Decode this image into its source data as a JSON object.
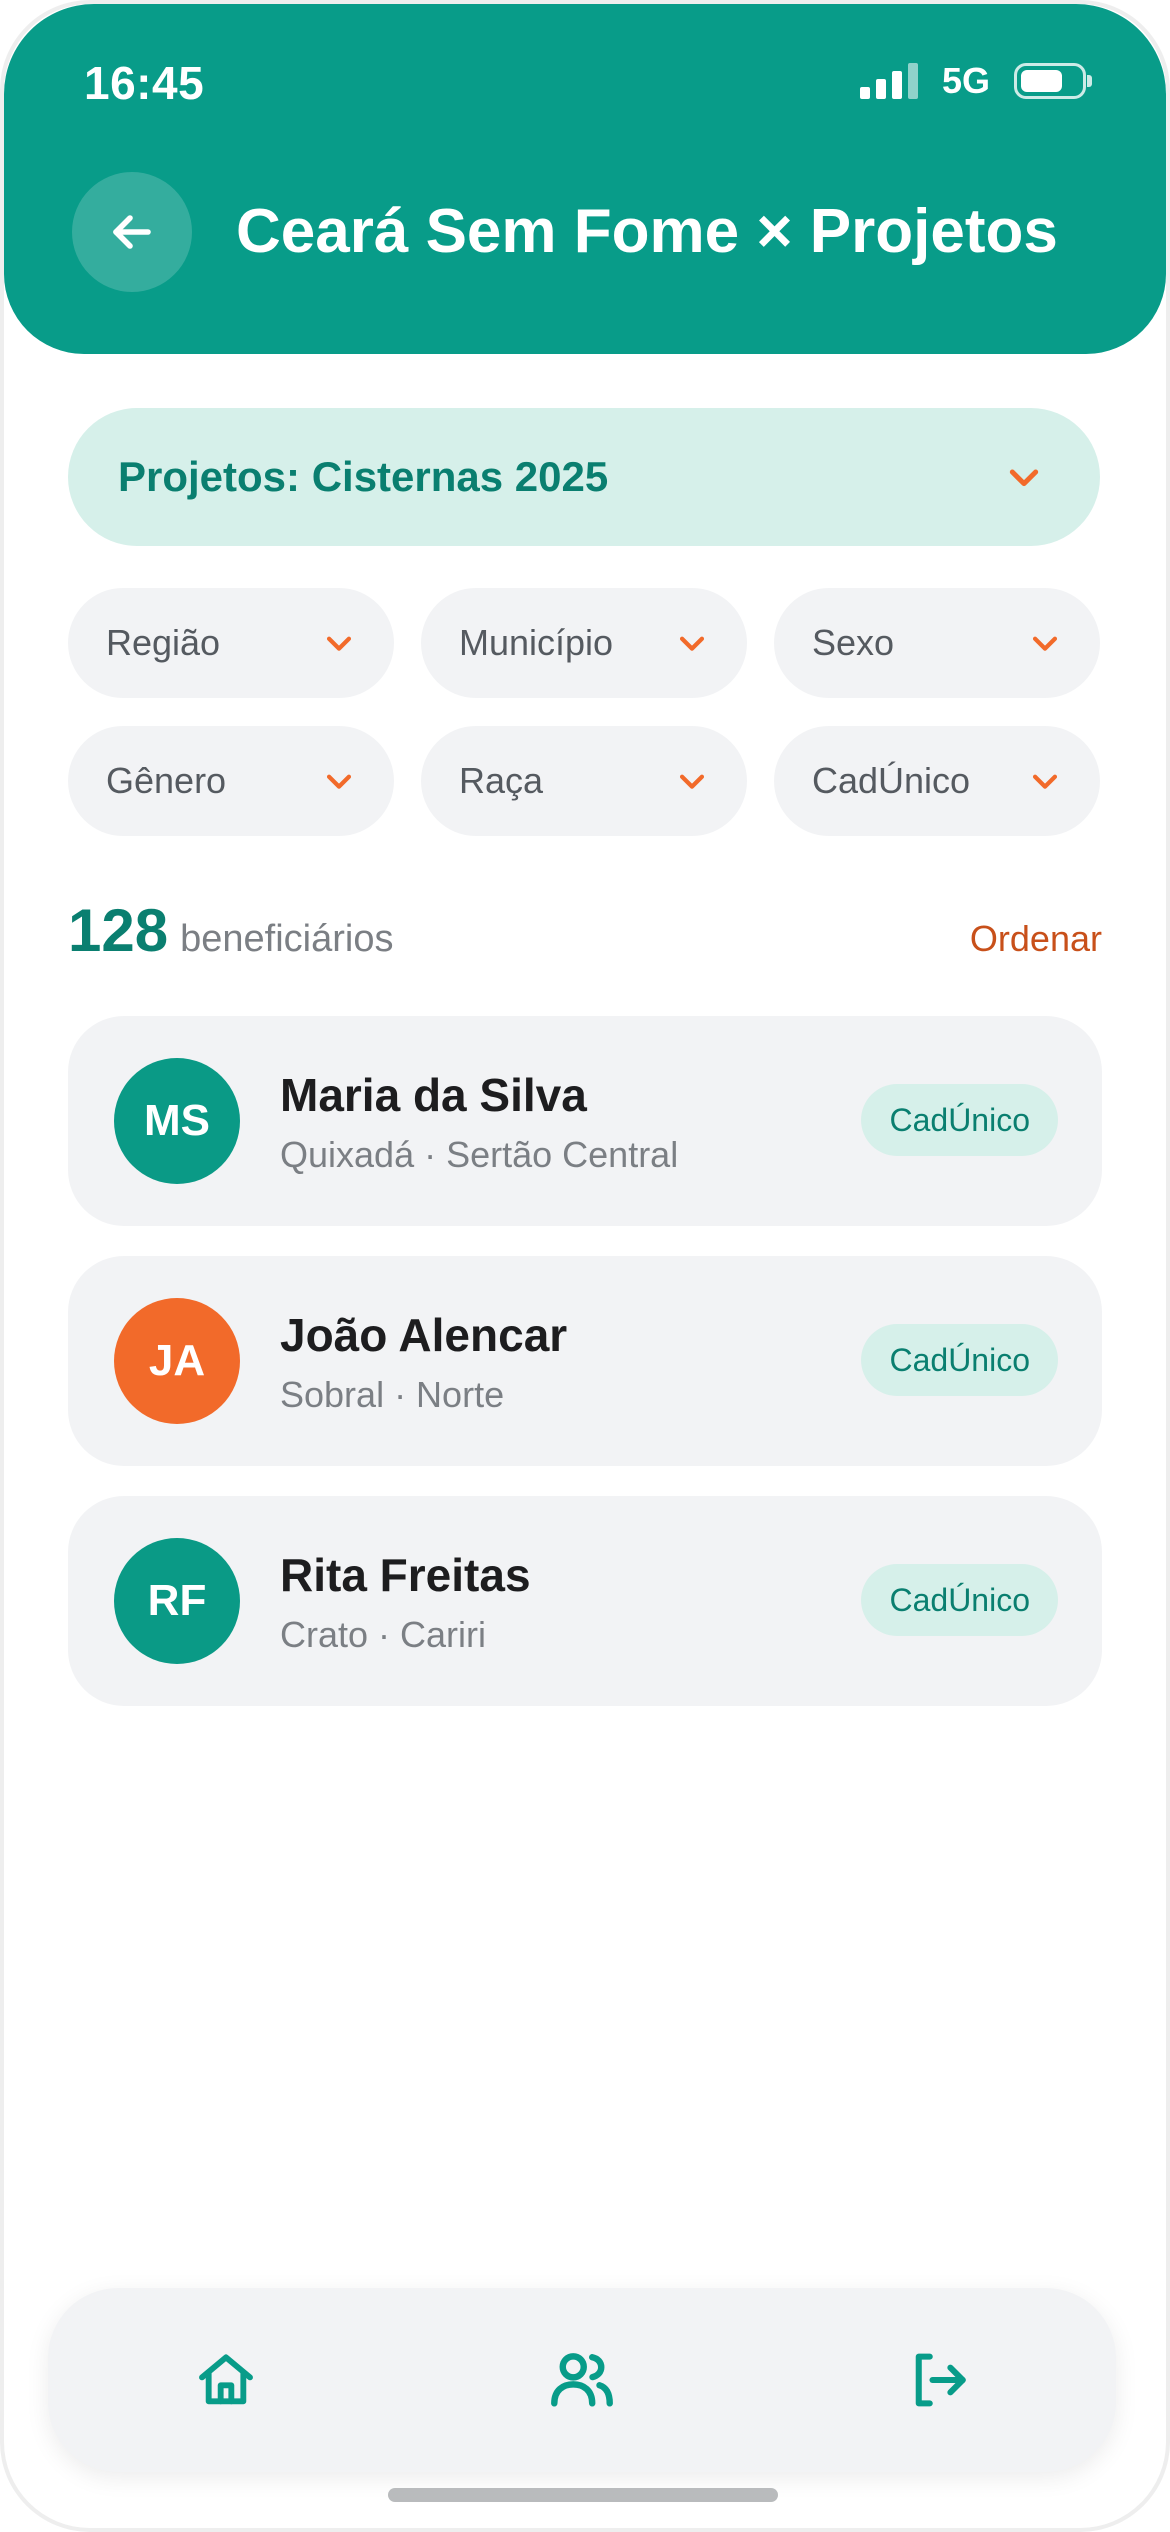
{
  "status_bar": {
    "time": "16:45",
    "network": "5G",
    "battery_level": 0.7
  },
  "header": {
    "title": "Ceará Sem Fome × Projetos",
    "back_icon": "arrow-left-icon"
  },
  "project_select": {
    "label": "Projetos: Cisternas 2025"
  },
  "filters": [
    {
      "label": "Região"
    },
    {
      "label": "Município"
    },
    {
      "label": "Sexo"
    },
    {
      "label": "Gênero"
    },
    {
      "label": "Raça"
    },
    {
      "label": "CadÚnico"
    }
  ],
  "summary": {
    "count": "128",
    "unit": "beneficiários",
    "sort_label": "Ordenar"
  },
  "beneficiaries": [
    {
      "initials": "MS",
      "name": "Maria da Silva",
      "place": "Quixadá · Sertão Central",
      "badge": "CadÚnico",
      "avatar_color": "#0a9a86"
    },
    {
      "initials": "JA",
      "name": "João Alencar",
      "place": "Sobral · Norte",
      "badge": "CadÚnico",
      "avatar_color": "#f26a2a"
    },
    {
      "initials": "RF",
      "name": "Rita Freitas",
      "place": "Crato · Cariri",
      "badge": "CadÚnico",
      "avatar_color": "#0a9a86"
    }
  ],
  "tabbar": {
    "items": [
      "home-icon",
      "users-icon",
      "logout-icon"
    ]
  },
  "colors": {
    "primary": "#089c89",
    "accent": "#f26a2a",
    "chip_bg": "#f2f3f5",
    "tint": "#d6f0ea"
  }
}
